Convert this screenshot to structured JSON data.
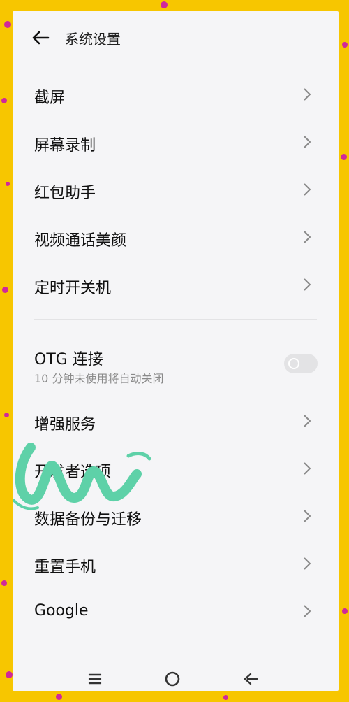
{
  "header": {
    "title": "系统设置",
    "back_icon": "arrow-left-icon"
  },
  "settings_group_1": [
    {
      "label": "截屏",
      "icon": "chevron-right-icon"
    },
    {
      "label": "屏幕录制",
      "icon": "chevron-right-icon"
    },
    {
      "label": "红包助手",
      "icon": "chevron-right-icon"
    },
    {
      "label": "视频通话美颜",
      "icon": "chevron-right-icon"
    },
    {
      "label": "定时开关机",
      "icon": "chevron-right-icon"
    }
  ],
  "otg": {
    "label": "OTG 连接",
    "subtitle": "10 分钟未使用将自动关闭",
    "enabled": false
  },
  "settings_group_2": [
    {
      "label": "增强服务",
      "icon": "chevron-right-icon"
    },
    {
      "label": "开发者选项",
      "icon": "chevron-right-icon"
    },
    {
      "label": "数据备份与迁移",
      "icon": "chevron-right-icon"
    },
    {
      "label": "重置手机",
      "icon": "chevron-right-icon"
    },
    {
      "label": "Google",
      "icon": "chevron-right-icon"
    }
  ],
  "navbar": {
    "items": [
      "menu-icon",
      "home-circle-icon",
      "back-icon"
    ]
  },
  "colors": {
    "background": "#f7c600",
    "panel": "#f5f5f7",
    "dots": "#d0289a",
    "scribble": "#5ed1a8"
  }
}
